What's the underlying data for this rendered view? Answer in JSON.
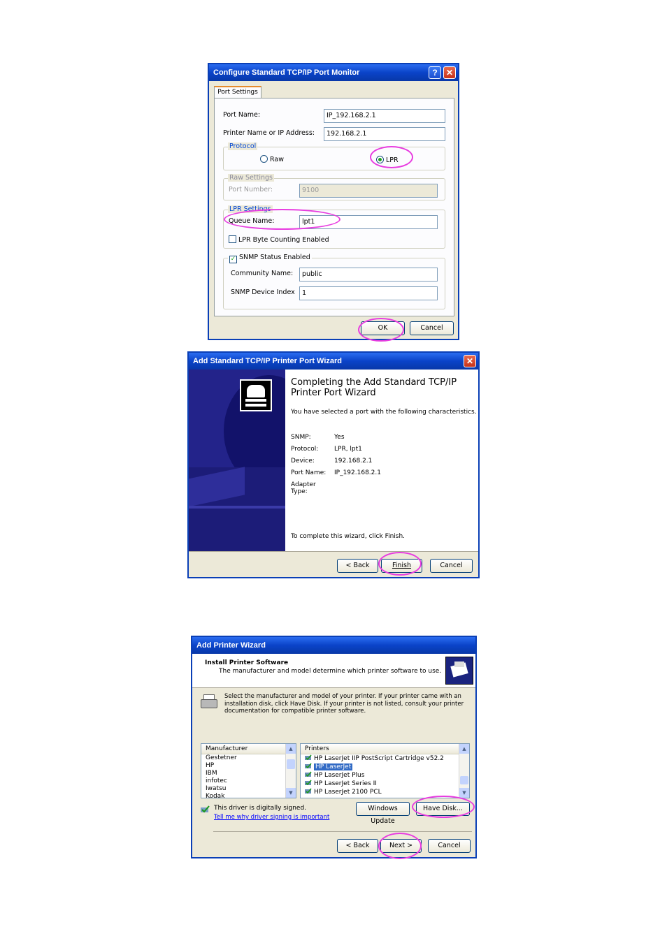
{
  "dialog1": {
    "title": "Configure Standard TCP/IP Port Monitor",
    "tab": "Port Settings",
    "port_name_label": "Port Name:",
    "port_name_value": "IP_192.168.2.1",
    "printer_ip_label": "Printer Name or IP Address:",
    "printer_ip_value": "192.168.2.1",
    "protocol_title": "Protocol",
    "raw_label": "Raw",
    "lpr_label": "LPR",
    "raw_settings_title": "Raw Settings",
    "port_number_label": "Port Number:",
    "port_number_value": "9100",
    "lpr_settings_title": "LPR Settings",
    "queue_name_label": "Queue Name:",
    "queue_name_value": "lpt1",
    "byte_counting_label": "LPR Byte Counting Enabled",
    "snmp_label": "SNMP Status Enabled",
    "community_label": "Community Name:",
    "community_value": "public",
    "device_index_label": "SNMP Device Index",
    "device_index_value": "1",
    "ok": "OK",
    "cancel": "Cancel"
  },
  "dialog2": {
    "title": "Add Standard TCP/IP Printer Port Wizard",
    "heading": "Completing the Add Standard TCP/IP Printer Port Wizard",
    "intro": "You have selected a port with the following characteristics.",
    "rows": [
      {
        "k": "SNMP:",
        "v": "Yes"
      },
      {
        "k": "Protocol:",
        "v": "LPR, lpt1"
      },
      {
        "k": "Device:",
        "v": "192.168.2.1"
      },
      {
        "k": "Port Name:",
        "v": "IP_192.168.2.1"
      },
      {
        "k": "Adapter Type:",
        "v": ""
      }
    ],
    "complete": "To complete this wizard, click Finish.",
    "back": "< Back",
    "finish": "Finish",
    "cancel": "Cancel"
  },
  "dialog3": {
    "title": "Add Printer Wizard",
    "header_title": "Install Printer Software",
    "header_sub": "The manufacturer and model determine which printer software to use.",
    "instructions": "Select the manufacturer and model of your printer. If your printer came with an installation disk, click Have Disk. If your printer is not listed, consult your printer documentation for compatible printer software.",
    "manufacturer_header": "Manufacturer",
    "manufacturers": [
      "Gestetner",
      "HP",
      "IBM",
      "infotec",
      "Iwatsu",
      "Kodak"
    ],
    "printers_header": "Printers",
    "printers": [
      "HP LaserJet IIP PostScript Cartridge v52.2",
      "HP LaserJet",
      "HP LaserJet Plus",
      "HP LaserJet Series II",
      "HP LaserJet 2100 PCL"
    ],
    "signed": "This driver is digitally signed.",
    "signing_link": "Tell me why driver signing is important",
    "windows_update": "Windows Update",
    "have_disk": "Have Disk...",
    "back": "< Back",
    "next": "Next >",
    "cancel": "Cancel"
  }
}
